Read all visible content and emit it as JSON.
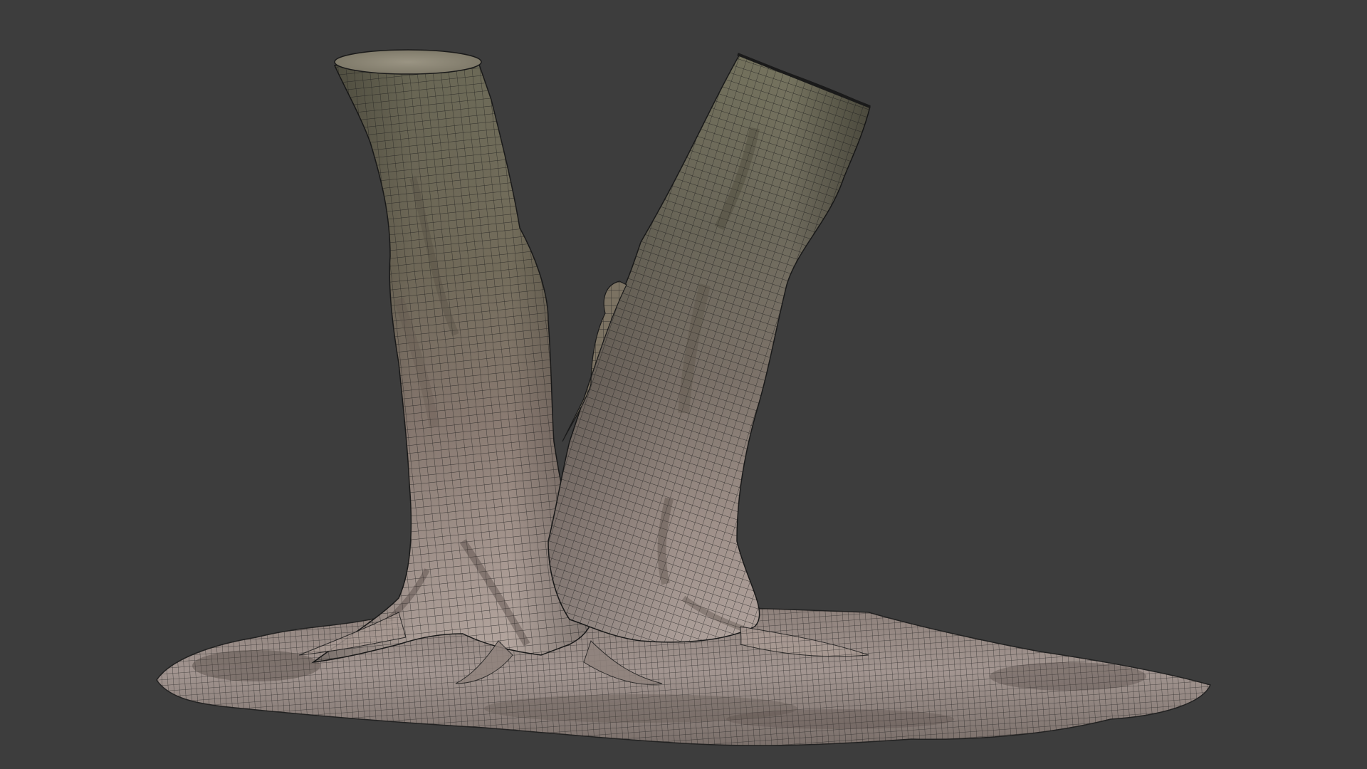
{
  "viewport": {
    "background_color": "#3d3d3d",
    "mesh_wire_color": "#1a1a1a",
    "bark_colors": [
      "#8a7f6e",
      "#6b6a55",
      "#9a8c82",
      "#5e5a4c",
      "#b8aba3"
    ],
    "cut_top_color": "#8d8878"
  },
  "model": {
    "icon": "tree-stump-mesh-icon"
  }
}
